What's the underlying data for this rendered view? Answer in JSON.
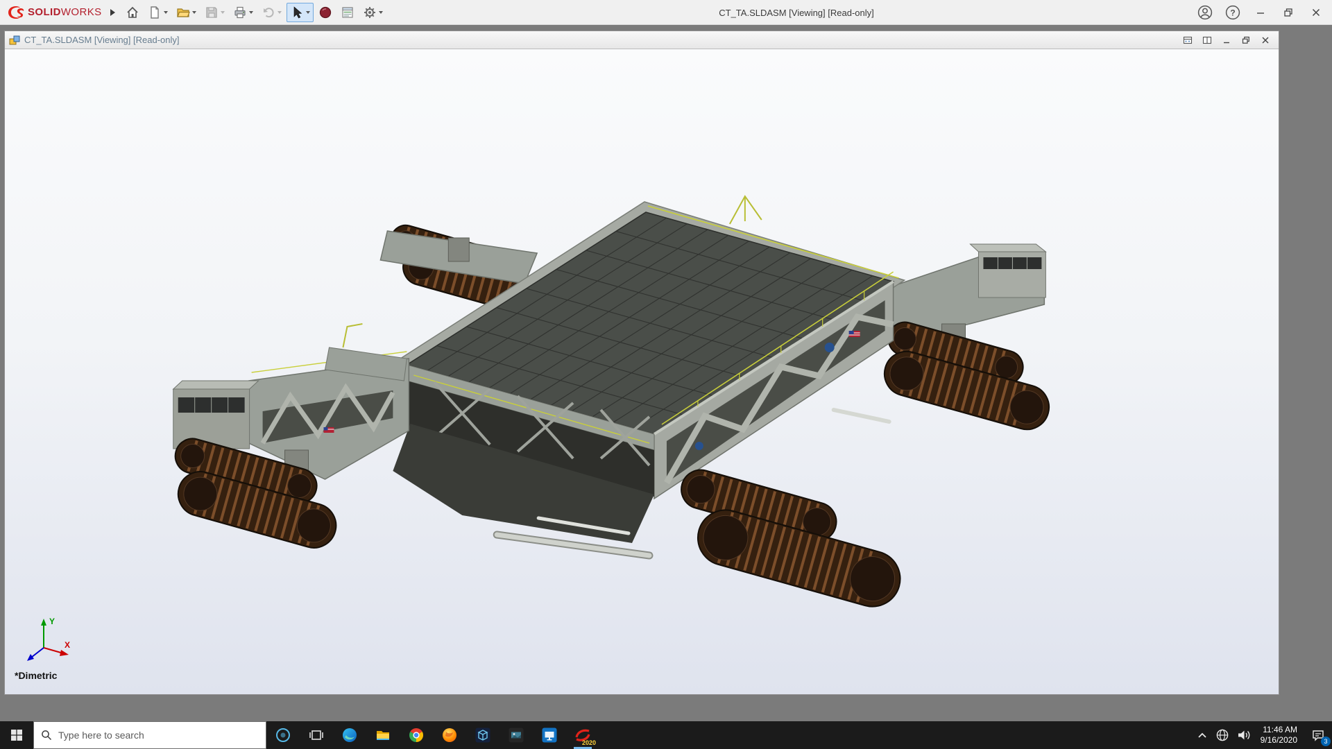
{
  "app": {
    "brand_solid": "SOLID",
    "brand_works": "WORKS",
    "title": "CT_TA.SLDASM [Viewing] [Read-only]"
  },
  "header": {
    "help_glyph": "?",
    "icons": [
      "account",
      "help",
      "minimize",
      "restore",
      "close"
    ]
  },
  "toolbar": {
    "icons": [
      "menu-flyout",
      "home",
      "new-document",
      "open",
      "save",
      "print",
      "undo",
      "select-cursor",
      "record",
      "evaluate-sheet",
      "settings"
    ],
    "selected_tool": "select-cursor",
    "disabled_tools": [
      "save",
      "undo"
    ]
  },
  "document": {
    "title": "CT_TA.SLDASM [Viewing] [Read-only]",
    "window_buttons": [
      "layout-window-1",
      "layout-window-2",
      "minimize",
      "restore",
      "close"
    ],
    "view_orientation": "*Dimetric",
    "axes": {
      "x": "X",
      "y": "Y"
    }
  },
  "model": {
    "body_color": "#a5a9a2",
    "deck_color": "#4a4e49",
    "track_color": "#35200f",
    "track_stripe_color": "#7c4e2a",
    "accent_color": "#c9cf3a",
    "flag_colors": {
      "field": "#b22234",
      "canton": "#2a3f8f"
    },
    "nasa_logo_color": "#27518f"
  },
  "taskbar": {
    "search_placeholder": "Type here to search",
    "icons": [
      "start",
      "search",
      "cortana",
      "task-view",
      "edge",
      "file-explorer",
      "browser",
      "firefox",
      "composer-cube",
      "media-app",
      "display-app",
      "solidworks-2020"
    ],
    "solidworks_badge": "2020",
    "tray": {
      "icons": [
        "hidden-icons-chevron",
        "network-globe",
        "volume",
        "action-center"
      ],
      "time": "11:46 AM",
      "date": "9/16/2020",
      "notification_count": "3"
    }
  }
}
